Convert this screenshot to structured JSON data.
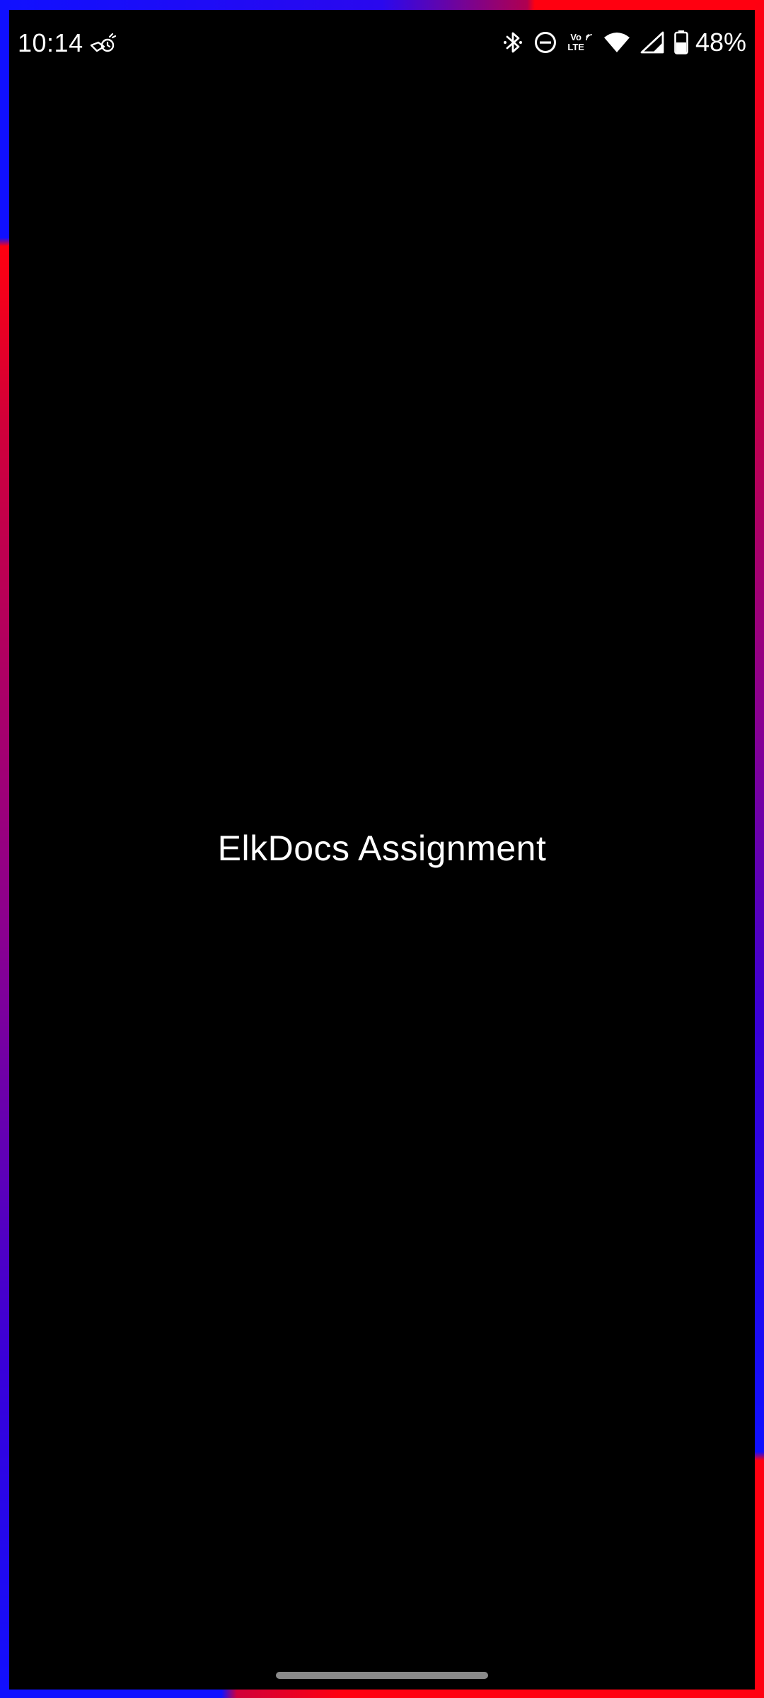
{
  "status_bar": {
    "time": "10:14",
    "app_notification_icon": "app-notification-icon",
    "icons": [
      "bluetooth-icon",
      "do-not-disturb-icon",
      "volte-icon",
      "wifi-icon",
      "cellular-signal-icon",
      "battery-icon"
    ],
    "volte_label_top": "Vo",
    "volte_label_bottom": "LTE",
    "battery_percent": "48%"
  },
  "screen": {
    "title": "ElkDocs Assignment"
  },
  "colors": {
    "background": "#000000",
    "border_blue": "#1010ff",
    "border_red": "#ff0010",
    "text": "#ffffff"
  }
}
